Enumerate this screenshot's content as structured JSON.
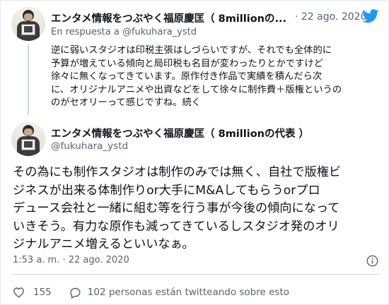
{
  "parent_tweet": {
    "author_name": "エンタメ情報をつぶやく福原慶匡（ 8millionの...",
    "date": "· 22 ago. 2020",
    "reply_prefix": "En respuesta a",
    "reply_handle": "@fukuhara_ystd",
    "body_lines": [
      "逆に弱いスタジオは印税主張はしづらいですが、それでも全体的に",
      "予算が増えている傾向と局印税も名目が変わったりとかですけど",
      "徐々に無くなってきています。原作付き作品で実績を積んだら次",
      "に、オリジナルアニメや出資などをして徐々に制作費＋版権というの",
      "のがセオリーって感じですね。続く"
    ]
  },
  "main_tweet": {
    "author_name": "エンタメ情報をつぶやく福原慶匡（ 8millionの代表 ）",
    "handle": "@fukuhara_ystd",
    "body_lines": [
      "その為にも制作スタジオは制作のみでは無く、自社で版権ビ",
      "ジネスが出来る体制作りor大手にM&Aしてもらうorプロ",
      "デュース会社と一緒に組む等を行う事が今後の傾向になって",
      "いきそう。有力な原作も減ってきているしスタジオ発のオリ",
      "ジナルアニメ増えるといいなぁ。"
    ],
    "timestamp": "1:53 a. m. · 22 ago. 2020",
    "like_count": "155",
    "people_talking": "102 personas están twitteando sobre esto"
  },
  "icons": {
    "brand": "twitter-bird-icon",
    "info": "info-icon",
    "like": "heart-icon",
    "reply": "speech-bubble-icon"
  },
  "colors": {
    "brand_blue": "#1d9bf0",
    "muted_text": "#536471",
    "main_text": "#0f1419",
    "divider": "#cfd9de"
  }
}
